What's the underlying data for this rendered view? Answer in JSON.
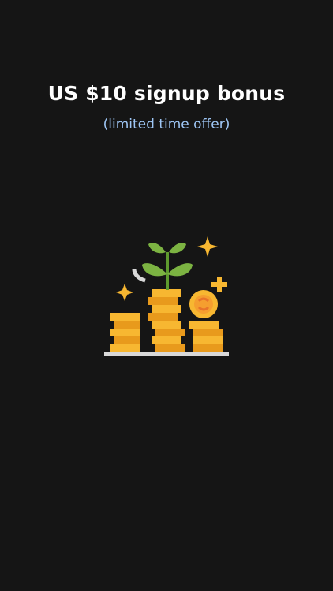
{
  "promo": {
    "title": "US $10 signup bonus",
    "subtitle": "(limited time offer)"
  },
  "illustration": {
    "icon": "money-growth-icon"
  },
  "colors": {
    "background": "#151515",
    "title": "#ffffff",
    "subtitle": "#9ec6f5",
    "coin": "#f7b731",
    "coin_shadow": "#e89a1c",
    "leaf": "#7cb342",
    "stem": "#5e9b2e",
    "ground": "#d8d8d8"
  }
}
